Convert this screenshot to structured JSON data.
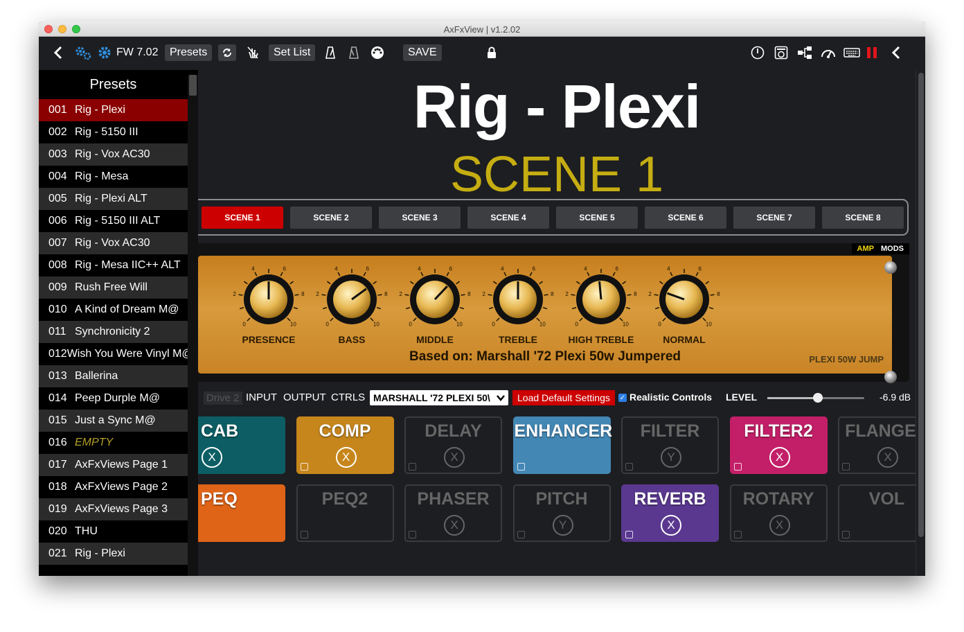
{
  "window": {
    "title": "AxFxView | v1.2.02"
  },
  "toolbar": {
    "back_icon": "chevron-left-icon",
    "firmware": "FW 7.02",
    "presets_label": "Presets",
    "refresh_icon": "refresh-icon",
    "tap_icon": "tap-icon",
    "setlist_label": "Set List",
    "save_label": "SAVE",
    "right_icons": [
      "power-icon",
      "amp-icon",
      "network-icon",
      "gauge-icon",
      "keyboard-icon",
      "meter-icon",
      "chevron-left-icon"
    ]
  },
  "sidebar": {
    "title": "Presets",
    "presets": [
      {
        "num": "001",
        "name": "Rig - Plexi",
        "active": true
      },
      {
        "num": "002",
        "name": "Rig - 5150 III"
      },
      {
        "num": "003",
        "name": "Rig - Vox AC30"
      },
      {
        "num": "004",
        "name": "Rig - Mesa"
      },
      {
        "num": "005",
        "name": "Rig - Plexi ALT"
      },
      {
        "num": "006",
        "name": "Rig - 5150 III ALT"
      },
      {
        "num": "007",
        "name": "Rig - Vox AC30"
      },
      {
        "num": "008",
        "name": "Rig - Mesa IIC++ ALT"
      },
      {
        "num": "009",
        "name": "Rush Free Will"
      },
      {
        "num": "010",
        "name": "A Kind of Dream M@"
      },
      {
        "num": "011",
        "name": "Synchronicity 2"
      },
      {
        "num": "012",
        "name": "Wish You Were Vinyl M@"
      },
      {
        "num": "013",
        "name": "Ballerina"
      },
      {
        "num": "014",
        "name": "Peep Durple M@"
      },
      {
        "num": "015",
        "name": "Just a Sync M@"
      },
      {
        "num": "016",
        "name": "EMPTY",
        "empty": true
      },
      {
        "num": "017",
        "name": "AxFxViews Page 1"
      },
      {
        "num": "018",
        "name": "AxFxViews Page 2"
      },
      {
        "num": "019",
        "name": "AxFxViews Page 3"
      },
      {
        "num": "020",
        "name": "THU"
      },
      {
        "num": "021",
        "name": "Rig - Plexi"
      }
    ]
  },
  "main": {
    "preset_title": "Rig - Plexi",
    "scene_title": "SCENE 1",
    "scenes": [
      "SCENE 1",
      "SCENE 2",
      "SCENE 3",
      "SCENE 4",
      "SCENE 5",
      "SCENE 6",
      "SCENE 7",
      "SCENE 8"
    ],
    "active_scene": 0
  },
  "amp": {
    "modes": {
      "amp": "AMP",
      "mods": "MODS"
    },
    "knobs": [
      {
        "label": "PRESENCE",
        "value": 5.0
      },
      {
        "label": "BASS",
        "value": 7.0
      },
      {
        "label": "MIDDLE",
        "value": 6.6
      },
      {
        "label": "TREBLE",
        "value": 5.0
      },
      {
        "label": "HIGH TREBLE",
        "value": 4.8
      },
      {
        "label": "NORMAL",
        "value": 2.4
      }
    ],
    "scale_labels": {
      "min": "0",
      "max": "10",
      "tick2": "2",
      "tick4": "4",
      "tick6": "6",
      "tick8": "8"
    },
    "based_on": "Based on: Marshall '72 Plexi 50w Jumpered",
    "model": "PLEXI 50W JUMP"
  },
  "controls": {
    "drive_tab": "Drive 2",
    "tabs": [
      "INPUT",
      "OUTPUT",
      "CTRLS"
    ],
    "amp_select": "MARSHALL '72 PLEXI 50\\",
    "load_default": "Load Default Settings",
    "realistic_label": "Realistic Controls",
    "realistic_checked": true,
    "level_label": "LEVEL",
    "level_value": "-6.9 dB",
    "level_fraction": 0.52
  },
  "blocks": [
    {
      "name": "CAB",
      "circle": "X",
      "on": true,
      "color": "#0c5e64"
    },
    {
      "name": "COMP",
      "circle": "X",
      "on": true,
      "color": "#c7861c"
    },
    {
      "name": "DELAY",
      "circle": "X",
      "on": false
    },
    {
      "name": "ENHANCER",
      "circle": "",
      "on": true,
      "color": "#4387b5"
    },
    {
      "name": "FILTER",
      "circle": "Y",
      "on": false
    },
    {
      "name": "FILTER2",
      "circle": "X",
      "on": true,
      "color": "#c31f68"
    },
    {
      "name": "FLANGER",
      "circle": "X",
      "on": false
    },
    {
      "name": "PEQ",
      "circle": "",
      "on": true,
      "color": "#df6417"
    },
    {
      "name": "PEQ2",
      "circle": "",
      "on": false
    },
    {
      "name": "PHASER",
      "circle": "X",
      "on": false
    },
    {
      "name": "PITCH",
      "circle": "Y",
      "on": false
    },
    {
      "name": "REVERB",
      "circle": "X",
      "on": true,
      "color": "#5a3890"
    },
    {
      "name": "ROTARY",
      "circle": "X",
      "on": false
    },
    {
      "name": "VOL",
      "circle": "",
      "on": false
    }
  ]
}
